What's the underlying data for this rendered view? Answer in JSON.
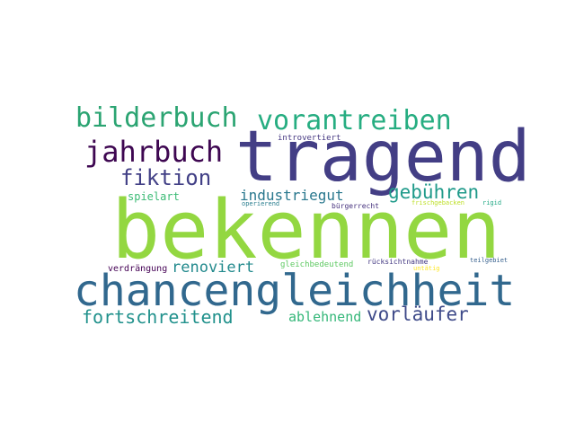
{
  "word_cloud": {
    "words": [
      {
        "id": "tragend",
        "text": "tragend",
        "color": "#433e85"
      },
      {
        "id": "bekennen",
        "text": "bekennen",
        "color": "#93d741"
      },
      {
        "id": "chancengleichheit",
        "text": "chancengleichheit",
        "color": "#31688e"
      },
      {
        "id": "bilderbuch",
        "text": "bilderbuch",
        "color": "#2ba472"
      },
      {
        "id": "vorantreiben",
        "text": "vorantreiben",
        "color": "#26ad81"
      },
      {
        "id": "jahrbuch",
        "text": "jahrbuch",
        "color": "#3e0751"
      },
      {
        "id": "fiktion",
        "text": "fiktion",
        "color": "#424086"
      },
      {
        "id": "gebuehren",
        "text": "gebühren",
        "color": "#1f9a8a"
      },
      {
        "id": "industriegut",
        "text": "industriegut",
        "color": "#2a788e"
      },
      {
        "id": "spielart",
        "text": "spielart",
        "color": "#3bbb75"
      },
      {
        "id": "renoviert",
        "text": "renoviert",
        "color": "#238a8d"
      },
      {
        "id": "fortschreitend",
        "text": "fortschreitend",
        "color": "#21918c"
      },
      {
        "id": "ablehnend",
        "text": "ablehnend",
        "color": "#35b779"
      },
      {
        "id": "vorlaeufer",
        "text": "vorläufer",
        "color": "#3e4a89"
      },
      {
        "id": "introvertiert",
        "text": "introvertiert",
        "color": "#453781"
      },
      {
        "id": "operierend",
        "text": "operierend",
        "color": "#287d8e"
      },
      {
        "id": "buergerrecht",
        "text": "bürgerrecht",
        "color": "#46327e"
      },
      {
        "id": "frischgebacken",
        "text": "frischgebacken",
        "color": "#bddf26"
      },
      {
        "id": "rigid",
        "text": "rigid",
        "color": "#22a884"
      },
      {
        "id": "verdraengung",
        "text": "verdrängung",
        "color": "#440154"
      },
      {
        "id": "gleichbedeutend",
        "text": "gleichbedeutend",
        "color": "#5ec962"
      },
      {
        "id": "ruecksichtnahme",
        "text": "rücksichtnahme",
        "color": "#443a83"
      },
      {
        "id": "teilgebiet",
        "text": "teilgebiet",
        "color": "#355f8d"
      },
      {
        "id": "untaetig",
        "text": "untätig",
        "color": "#fde725"
      }
    ]
  }
}
